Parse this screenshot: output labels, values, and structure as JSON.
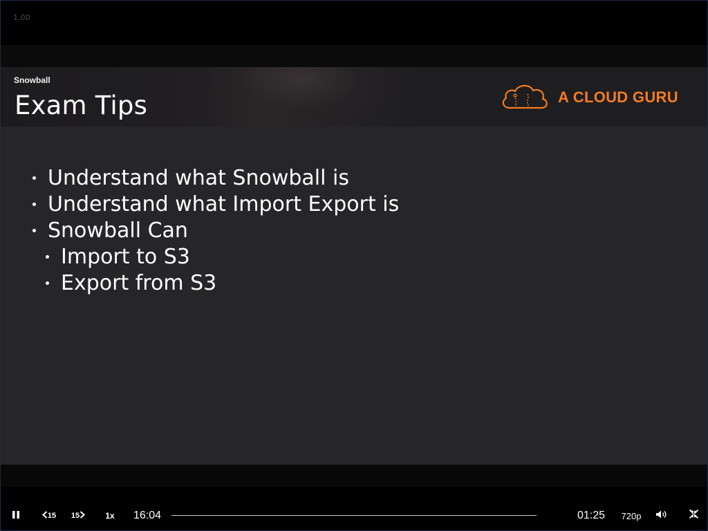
{
  "overlay": {
    "speed_readout": "1.00"
  },
  "slide": {
    "section_label": "Snowball",
    "title": "Exam Tips",
    "brand": {
      "name": "A CLOUD GURU",
      "color": "#f47c20"
    },
    "bullets": [
      {
        "text": "Understand what Snowball is",
        "level": 1
      },
      {
        "text": "Understand what Import Export is",
        "level": 1
      },
      {
        "text": "Snowball Can",
        "level": 1
      },
      {
        "text": "Import to S3",
        "level": 2
      },
      {
        "text": "Export from S3",
        "level": 2
      }
    ]
  },
  "player": {
    "play_state_icon": "pause-icon",
    "skip_back_label": "15",
    "skip_forward_label": "15",
    "speed_label": "1x",
    "time_elapsed": "16:04",
    "time_remaining": "01:25",
    "progress_fraction": 0.0,
    "quality_label": "720p",
    "volume_icon": "volume-icon",
    "fullscreen_icon": "exit-fullscreen-icon"
  }
}
